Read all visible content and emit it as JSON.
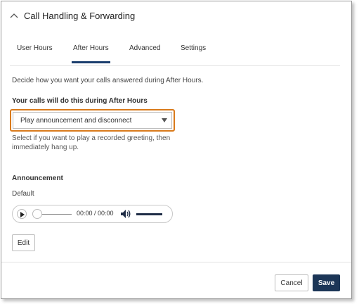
{
  "panel": {
    "title": "Call Handling & Forwarding"
  },
  "tabs": [
    {
      "label": "User Hours",
      "active": false
    },
    {
      "label": "After Hours",
      "active": true
    },
    {
      "label": "Advanced",
      "active": false
    },
    {
      "label": "Settings",
      "active": false
    }
  ],
  "after_hours": {
    "description": "Decide how you want your calls answered during After Hours.",
    "select_label": "Your calls will do this during After Hours",
    "selected_option": "Play announcement and disconnect",
    "help_text": "Select if you want to play a recorded greeting, then immediately hang up."
  },
  "announcement": {
    "section_title": "Announcement",
    "name": "Default",
    "player": {
      "time": "00:00 / 00:00",
      "progress": 0
    },
    "edit_label": "Edit"
  },
  "footer": {
    "cancel_label": "Cancel",
    "save_label": "Save"
  },
  "colors": {
    "accent": "#1c3f6e",
    "highlight_outline": "#d97a1b",
    "save_button": "#1c3657"
  }
}
